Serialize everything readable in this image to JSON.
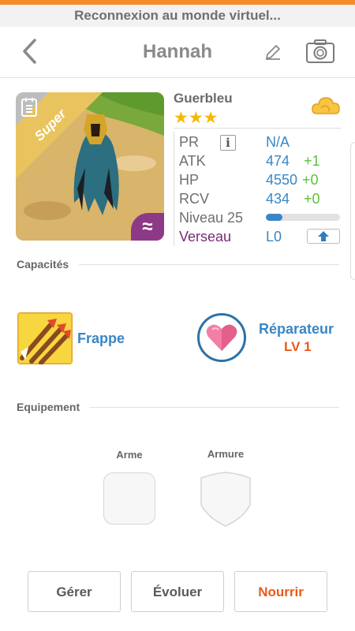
{
  "status": {
    "reconnect_text": "Reconnexion au monde virtuel..."
  },
  "header": {
    "title": "Hannah",
    "back_icon": "chevron-left-icon",
    "edit_icon": "pencil-icon",
    "camera_icon": "camera-icon"
  },
  "portrait": {
    "badge_text": "Super",
    "element_icon": "wave-icon",
    "element_glyph": "≈",
    "book_icon": "book-icon"
  },
  "character": {
    "name": "Guerbleu",
    "stars": "★★★",
    "star_count": 3,
    "cloud_icon": "cloud-icon"
  },
  "stats": {
    "pr": {
      "label": "PR",
      "value": "N/A",
      "info": "i"
    },
    "atk": {
      "label": "ATK",
      "value": "474",
      "bonus": "+1"
    },
    "hp": {
      "label": "HP",
      "value": "4550",
      "bonus": "+0"
    },
    "rcv": {
      "label": "RCV",
      "value": "434",
      "bonus": "+0"
    },
    "level": {
      "label": "Niveau 25",
      "progress": 0.22
    },
    "element": {
      "label": "Verseau",
      "value": "L0"
    }
  },
  "sections": {
    "capacites": "Capacités",
    "equipement": "Equipement"
  },
  "abilities": {
    "skill_name": "Frappe",
    "passive_name": "Réparateur",
    "passive_level": "LV 1"
  },
  "equipment": {
    "weapon_label": "Arme",
    "armor_label": "Armure"
  },
  "buttons": {
    "manage": "Gérer",
    "evolve": "Évoluer",
    "feed": "Nourrir"
  },
  "colors": {
    "accent_blue": "#3a86c5",
    "bonus_green": "#5ac33a",
    "feed_orange": "#ea5a1a",
    "element_purple": "#8d3a86",
    "star_yellow": "#f5b800"
  }
}
